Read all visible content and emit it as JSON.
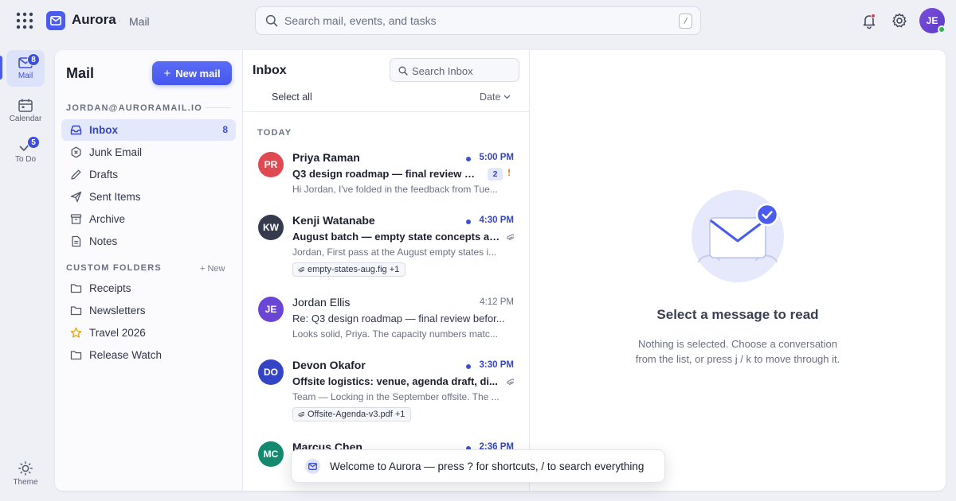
{
  "app": {
    "name": "Aurora",
    "section": "Mail"
  },
  "search": {
    "placeholder": "Search mail, events, and tasks",
    "shortcut": "/"
  },
  "user": {
    "initials": "JE"
  },
  "rail": [
    {
      "label": "Mail",
      "badge": "8",
      "icon": "mail-icon"
    },
    {
      "label": "Calendar",
      "badge": "",
      "icon": "calendar-icon"
    },
    {
      "label": "To Do",
      "badge": "5",
      "icon": "checkmark-icon"
    },
    {
      "label": "Theme",
      "badge": "",
      "icon": "sun-icon"
    }
  ],
  "folders_pane": {
    "title": "Mail",
    "new_mail_label": "New mail",
    "account": "JORDAN@AURORAMAIL.IO",
    "folders": [
      {
        "label": "Inbox",
        "count": "8",
        "icon": "inbox-icon"
      },
      {
        "label": "Junk Email",
        "count": "",
        "icon": "shield-x-icon"
      },
      {
        "label": "Drafts",
        "count": "",
        "icon": "pencil-icon"
      },
      {
        "label": "Sent Items",
        "count": "",
        "icon": "paper-plane-icon"
      },
      {
        "label": "Archive",
        "count": "",
        "icon": "archive-box-icon"
      },
      {
        "label": "Notes",
        "count": "",
        "icon": "note-icon"
      }
    ],
    "custom_label": "CUSTOM FOLDERS",
    "custom_new": "+ New",
    "custom_folders": [
      {
        "label": "Receipts",
        "icon": "folder-icon"
      },
      {
        "label": "Newsletters",
        "icon": "folder-icon"
      },
      {
        "label": "Travel 2026",
        "icon": "star-icon"
      },
      {
        "label": "Release Watch",
        "icon": "folder-icon"
      }
    ]
  },
  "list": {
    "title": "Inbox",
    "search_placeholder": "Search Inbox",
    "select_all": "Select all",
    "sort_label": "Date",
    "group_label": "TODAY",
    "messages": [
      {
        "initials": "PR",
        "avatar_color": "#df4a52",
        "sender": "Priya Raman",
        "time": "5:00 PM",
        "unread": true,
        "subject": "Q3 design roadmap — final review b...",
        "preview": "Hi Jordan, I've folded in the feedback from Tue...",
        "thread_count": "2",
        "important": "!",
        "attachment": ""
      },
      {
        "initials": "KW",
        "avatar_color": "#353b4d",
        "sender": "Kenji Watanabe",
        "time": "4:30 PM",
        "unread": true,
        "subject": "August batch — empty state concepts at...",
        "preview": "Jordan, First pass at the August empty states i...",
        "thread_count": "",
        "important": "",
        "attachment": "empty-states-aug.fig +1"
      },
      {
        "initials": "JE",
        "avatar_color": "#6a45d6",
        "sender": "Jordan Ellis",
        "time": "4:12 PM",
        "unread": false,
        "subject": "Re: Q3 design roadmap — final review befor...",
        "preview": "Looks solid, Priya. The capacity numbers matc...",
        "thread_count": "",
        "important": "",
        "attachment": ""
      },
      {
        "initials": "DO",
        "avatar_color": "#3344c4",
        "sender": "Devon Okafor",
        "time": "3:30 PM",
        "unread": true,
        "subject": "Offsite logistics: venue, agenda draft, di...",
        "preview": "Team — Locking in the September offsite. The ...",
        "thread_count": "",
        "important": "",
        "attachment": "Offsite-Agenda-v3.pdf +1"
      },
      {
        "initials": "MC",
        "avatar_color": "#138a70",
        "sender": "Marcus Chen",
        "time": "2:36 PM",
        "unread": true,
        "subject": "",
        "preview": "",
        "thread_count": "",
        "important": "",
        "attachment": ""
      }
    ]
  },
  "reader": {
    "empty_title": "Select a message to read",
    "empty_line1": "Nothing is selected. Choose a conversation",
    "empty_line2": "from the list, or press j / k to move through it."
  },
  "toast": {
    "text": "Welcome to Aurora — press ? for shortcuts, / to search everything"
  },
  "colors": {
    "accent": "#4a5cf0",
    "accent_dark": "#3445c9",
    "important": "#e07d1a",
    "online": "#2fb45a"
  }
}
